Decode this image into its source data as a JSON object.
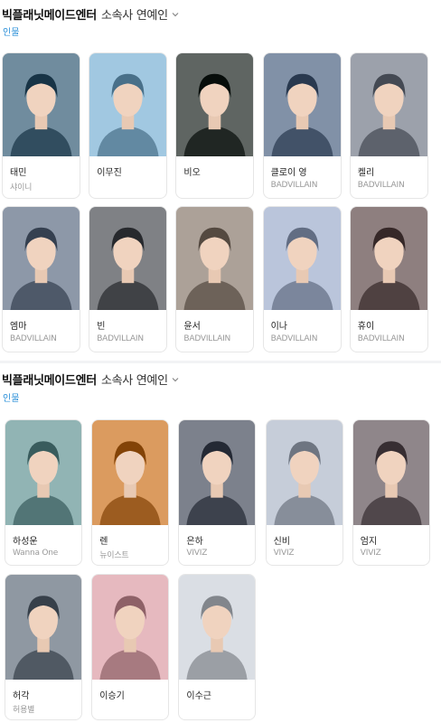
{
  "sections": [
    {
      "company": "빅플래닛메이드엔터",
      "relation": "소속사 연예인",
      "category": "인물",
      "people": [
        {
          "name": "태민",
          "affiliation": "샤이니",
          "tone": "#5e7a8c"
        },
        {
          "name": "이무진",
          "affiliation": "",
          "tone": "#8fb6cf"
        },
        {
          "name": "비오",
          "affiliation": "",
          "tone": "#4d5350"
        },
        {
          "name": "클로이 영",
          "affiliation": "BADVILLAIN",
          "tone": "#6f7f95"
        },
        {
          "name": "켈리",
          "affiliation": "BADVILLAIN",
          "tone": "#8a8f99"
        },
        {
          "name": "엠마",
          "affiliation": "BADVILLAIN",
          "tone": "#7b8696"
        },
        {
          "name": "빈",
          "affiliation": "BADVILLAIN",
          "tone": "#6d6f73"
        },
        {
          "name": "윤서",
          "affiliation": "BADVILLAIN",
          "tone": "#9a8f86"
        },
        {
          "name": "이나",
          "affiliation": "BADVILLAIN",
          "tone": "#a8b3c9"
        },
        {
          "name": "휴이",
          "affiliation": "BADVILLAIN",
          "tone": "#7c6e6e"
        }
      ]
    },
    {
      "company": "빅플래닛메이드엔터",
      "relation": "소속사 연예인",
      "category": "인물",
      "people": [
        {
          "name": "하성운",
          "affiliation": "Wanna One",
          "tone": "#7fa2a3"
        },
        {
          "name": "렌",
          "affiliation": "뉴이스트",
          "tone": "#c9894d"
        },
        {
          "name": "은하",
          "affiliation": "VIVIZ",
          "tone": "#6a6f7a"
        },
        {
          "name": "신비",
          "affiliation": "VIVIZ",
          "tone": "#b4bbc7"
        },
        {
          "name": "엄지",
          "affiliation": "VIVIZ",
          "tone": "#7d7478"
        },
        {
          "name": "허각",
          "affiliation": "허용별",
          "tone": "#7d8690"
        },
        {
          "name": "이승기",
          "affiliation": "",
          "tone": "#d4a7ad"
        },
        {
          "name": "이수근",
          "affiliation": "",
          "tone": "#c8ccd2"
        }
      ]
    }
  ],
  "icons": {
    "chevron": "chevron-down-icon"
  }
}
